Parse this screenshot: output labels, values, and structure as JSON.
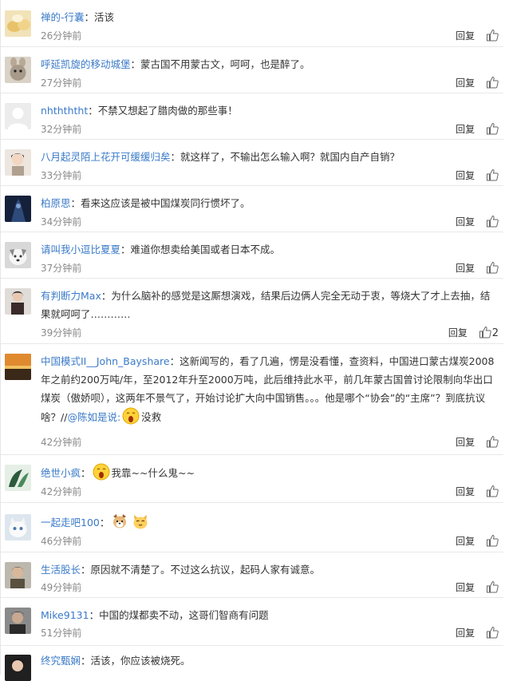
{
  "comments": [
    {
      "user": "禅的-行囊",
      "text": "活该",
      "time": "26分钟前",
      "reply": "回复",
      "likes": "",
      "avatar_color": "#e8c26a"
    },
    {
      "user": "呼延凯旋的移动城堡",
      "text": "蒙古国不用蒙古文，呵呵，也是醉了。",
      "time": "27分钟前",
      "reply": "回复",
      "likes": "",
      "avatar_color": "#a89a8a"
    },
    {
      "user": "nhthththt",
      "text": "不禁又想起了腊肉做的那些事！",
      "time": "32分钟前",
      "reply": "回复",
      "likes": "",
      "avatar_color": "#e4e4e4"
    },
    {
      "user": "八月起灵陌上花开可缓缓归矣",
      "text": "就这样了，不输出怎么输入啊？就国内自产自销？",
      "time": "33分钟前",
      "reply": "回复",
      "likes": "",
      "avatar_color": "#c7b8a8"
    },
    {
      "user": "柏原思",
      "text": "看来这应该是被中国煤炭同行惯坏了。",
      "time": "34分钟前",
      "reply": "回复",
      "likes": "",
      "avatar_color": "#1f2d4a"
    },
    {
      "user": "请叫我小逗比夏夏",
      "text": "难道你想卖给美国或者日本不成。",
      "time": "37分钟前",
      "reply": "回复",
      "likes": "",
      "avatar_color": "#cfcfcf"
    },
    {
      "user": "有判断力Max",
      "text": "为什么脑补的感觉是这厮想演戏，结果后边俩人完全无动于衷，等烧大了才上去抽，结果就呵呵了…………",
      "time": "39分钟前",
      "reply": "回复",
      "likes": "2",
      "avatar_color": "#4a3a3a"
    },
    {
      "user": "中国模式II__John_Bayshare",
      "text": "这新闻写的，看了几遍，愣是没看懂，查资料，中国进口蒙古煤炭2008年之前约200万吨/年，至2012年升至2000万吨，此后维持此水平，前几年蒙古国曾讨论限制向华出口煤炭（傲娇呗），这两年不景气了，开始讨论扩大向中国销售。。。他是哪个“协会”的“主席”？到底抗议啥？//",
      "mention": "@陈如是说:",
      "text_after": "没救",
      "time": "42分钟前",
      "reply": "回复",
      "likes": "",
      "avatar_color": "#c96a2a"
    },
    {
      "user": "绝世小疯",
      "text": "我靠~~什么鬼~~",
      "time": "42分钟前",
      "reply": "回复",
      "likes": "",
      "avatar_color": "#2c5a3a"
    },
    {
      "user": "一起走吧100",
      "text": "",
      "time": "46分钟前",
      "reply": "回复",
      "likes": "",
      "avatar_color": "#dde6ee"
    },
    {
      "user": "生活股长",
      "text": "原因就不清楚了。不过这么抗议，起码人家有诚意。",
      "time": "49分钟前",
      "reply": "回复",
      "likes": "",
      "avatar_color": "#6a6050"
    },
    {
      "user": "Mike9131",
      "text": "中国的煤都卖不动，这哥们智商有问题",
      "time": "51分钟前",
      "reply": "回复",
      "likes": "",
      "avatar_color": "#3a3a3a"
    },
    {
      "user": "终究甄娴",
      "text": "活该，你应该被烧死。",
      "time": "",
      "reply": "",
      "likes": "",
      "avatar_color": "#202020"
    }
  ],
  "colors": {
    "link": "#3a7ac8",
    "meta": "#8a8a8a",
    "divider": "#e8e8e8"
  }
}
